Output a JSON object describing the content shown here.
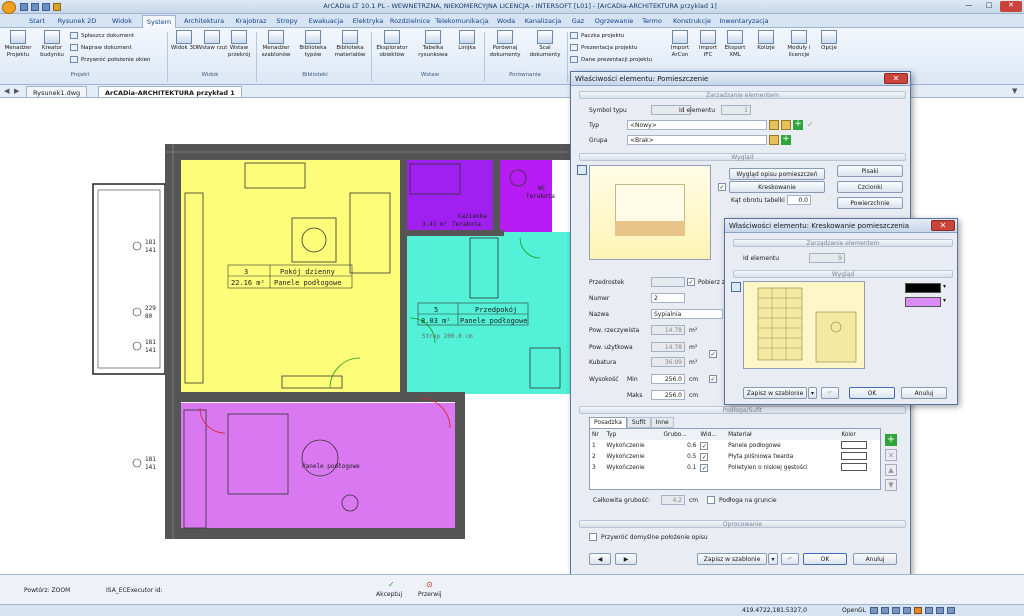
{
  "app": {
    "title": "ArCADia LT 10.1 PL - WEWNETRZNA, NIEKOMERCYJNA LICENCJA - INTERSOFT [L01] - [ArCADia-ARCHITEKTURA przyklad 1]",
    "win_min": "—",
    "win_max": "□",
    "win_close": "✕"
  },
  "ribbon_tabs": [
    "Start",
    "Rysunek 2D",
    "Widok",
    "System",
    "Architektura",
    "Krajobraz",
    "Stropy",
    "Ewakuacja",
    "Elektryka",
    "Rozdzielnice",
    "Telekomunikacja",
    "Woda",
    "Kanalizacja",
    "Gaz",
    "Ogrzewanie",
    "Termo",
    "Konstrukcje",
    "Inwentaryzacja"
  ],
  "ribbon": {
    "projekt": {
      "label": "Projekt",
      "b1": "Menadżer Projektu",
      "b2": "Kreator budynku",
      "s1": "Spłaszcz dokument",
      "s2": "Napraw dokument",
      "s3": "Przywróć położenie okien"
    },
    "widok": {
      "label": "Widok",
      "b1": "Widok 3D",
      "b2": "Wstaw rzut",
      "b3": "Wstaw przekrój"
    },
    "biblioteki": {
      "label": "Biblioteki",
      "b1": "Menadżer szablonów",
      "b2": "Biblioteka typów",
      "b3": "Biblioteka materiałów"
    },
    "wstaw": {
      "label": "Wstaw",
      "b1": "Eksplorator obiektów",
      "b2": "Tabelka rysunkowa",
      "b3": "Linijka"
    },
    "porownanie": {
      "label": "Porównanie",
      "b1": "Porównaj dokumenty",
      "b2": "Scal dokumenty"
    },
    "extra": {
      "s1": "Paczka projektu",
      "s2": "Prezentacja projektu",
      "s3": "Dane prezentacji projektu",
      "b1": "Import ArCon",
      "b2": "Import IFC",
      "b3": "Eksport XML",
      "b4": "Kolizje",
      "b5": "Moduły i licencje",
      "b6": "Opcje"
    }
  },
  "doc_tabs": [
    "Rysunek1.dwg",
    "ArCADia-ARCHITEKTURA przykład 1"
  ],
  "plan": {
    "room1_num": "3",
    "room1_name": "Pokój dzienny",
    "room1_area": "22.16 m²",
    "room1_floor": "Panele podłogowe",
    "room2_num": "5",
    "room2_name": "Przedpokój",
    "room2_area": "8.03 m²",
    "room2_floor": "Panele podłogowe",
    "room3_name": "Łazienka",
    "room3_area": "3.41 m²",
    "room3_floor": "Terakota",
    "room4_name": "WC",
    "room4_floor": "Terakota",
    "ceiling": "Strop 200.0 cm",
    "bedroom_floor": "Panele podłogowe",
    "dims": [
      "181",
      "141",
      "229",
      "80",
      "181",
      "141",
      "181",
      "141"
    ]
  },
  "dialog1": {
    "title": "Właściwości elementu: Pomieszczenie",
    "sec_manage": "Zarządzanie elementem",
    "symbol_label": "Symbol typu",
    "id_label": "Id elementu",
    "id_value": "1",
    "typ_label": "Typ",
    "typ_value": "<Nowy>",
    "grupa_label": "Grupa",
    "grupa_value": "<Brak>",
    "sec_look": "Wygląd",
    "opis_btn": "Wygląd opisu pomieszczeń",
    "kresk_btn": "Kreskowanie",
    "kat_label": "Kąt obrotu tabelki",
    "kat_value": "0.0",
    "pisaki": "Pisaki",
    "czcionki": "Czcionki",
    "powierzchnie": "Powierzchnie",
    "przedrostek": "Przedrostek",
    "pobierz": "Pobierz z",
    "numer_label": "Numer",
    "numer_value": "2",
    "nazwa_label": "Nazwa",
    "nazwa_value": "Sypialnia",
    "pow_rz_label": "Pow. rzeczywista",
    "pow_rz_value": "14.78",
    "unit_m2": "m²",
    "pow_uz_label": "Pow. użytkowa",
    "pow_uz_value": "14.78",
    "kub_label": "Kubatura",
    "kub_value": "36.99",
    "unit_m3": "m³",
    "wys_label": "Wysokość",
    "min_label": "Min",
    "min_value": "256.0",
    "max_label": "Maks",
    "max_value": "256.0",
    "unit_cm": "cm",
    "sec_floor": "Podłoga/Sufit",
    "tabs": [
      "Posadzka",
      "Sufit",
      "Inne"
    ],
    "cols": [
      "Nr",
      "Typ",
      "Grubo...",
      "Wid...",
      "Materiał",
      "Kolor"
    ],
    "rows": [
      {
        "nr": "1",
        "typ": "Wykończenie",
        "gr": "0.6",
        "mat": "Panele podłogowe"
      },
      {
        "nr": "2",
        "typ": "Wykończenie",
        "gr": "0.5",
        "mat": "Płyta pilśniowa twarda"
      },
      {
        "nr": "3",
        "typ": "Wykończenie",
        "gr": "0.1",
        "mat": "Polietylen o niskiej gęstości"
      }
    ],
    "total_label": "Całkowita grubość:",
    "total_value": "4.2",
    "podloga_gr": "Podłoga na gruncie",
    "sec_opr": "Oprocowanie",
    "restore": "Przywróć domyślne położenie opisu",
    "save_tpl": "Zapisz w szablonie",
    "ok": "OK",
    "cancel": "Anuluj"
  },
  "dialog2": {
    "title": "Właściwości elementu: Kreskowanie pomieszczenia",
    "sec_manage": "Zarządzanie elementem",
    "id_label": "Id elementu",
    "id_value": "9",
    "sec_look": "Wygląd",
    "save_tpl": "Zapisz w szablonie",
    "ok": "OK",
    "cancel": "Anuluj"
  },
  "cmdline": {
    "l1": "Powtórz: ZOOM",
    "l2": "ISA_ECExecutor id:",
    "accept": "Akceptuj",
    "cancel": "Przerwij"
  },
  "status": {
    "coords": "419.4722,181.5327,0",
    "render": "OpenGL"
  },
  "colors": {
    "yellow": "#fefd7a",
    "purple": "#d978f0",
    "violet": "#a020f0",
    "cyan": "#53f2d8"
  }
}
